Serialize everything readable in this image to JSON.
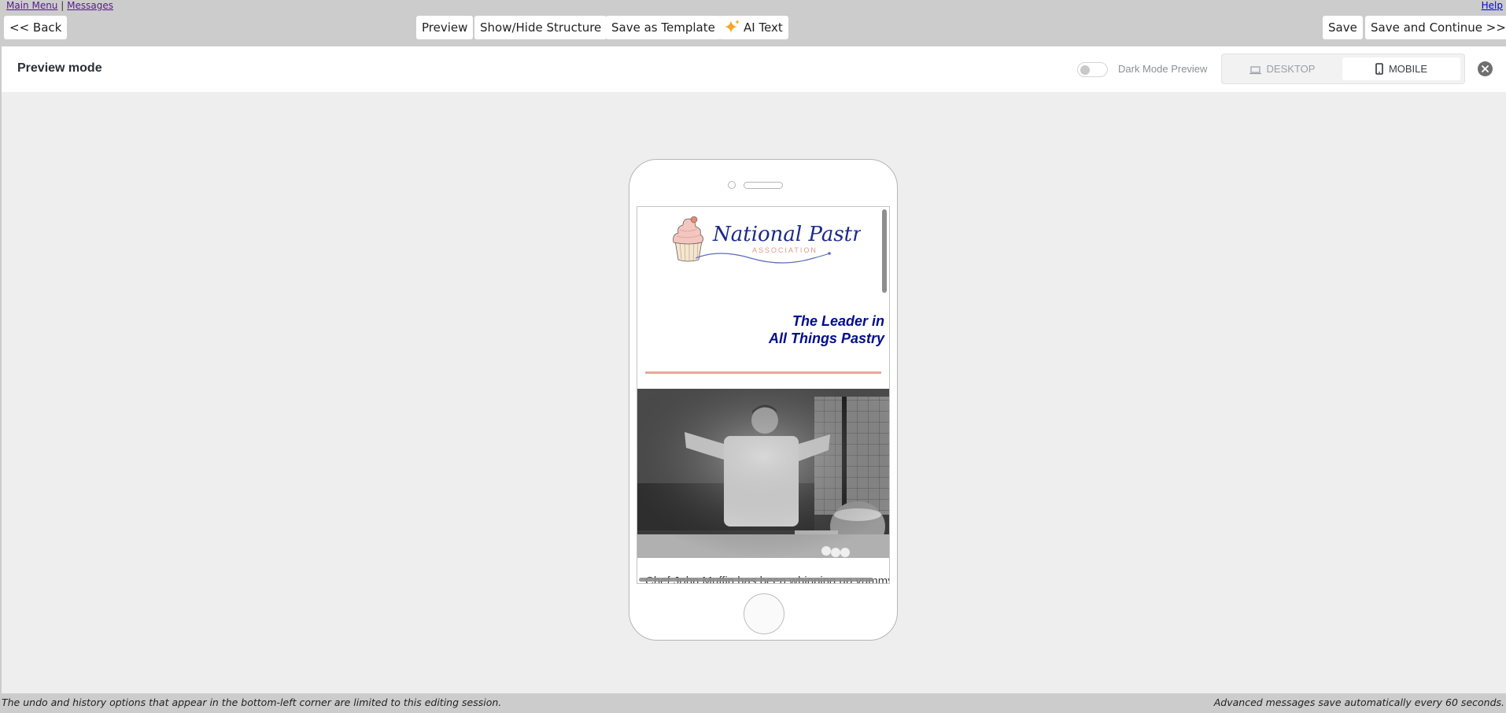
{
  "nav": {
    "main_menu": "Main Menu",
    "separator": "|",
    "messages": "Messages",
    "help": "Help"
  },
  "toolbar": {
    "back": "<< Back",
    "preview": "Preview",
    "show_hide_structure": "Show/Hide Structure",
    "save_as_template": "Save as Template",
    "ai_text": "AI Text",
    "ai_text_icon": "sparkle-icon",
    "save": "Save",
    "save_and_continue": "Save and Continue >>"
  },
  "preview_header": {
    "title": "Preview mode",
    "dark_mode_label": "Dark Mode Preview",
    "dark_mode_on": false,
    "device_options": [
      {
        "label": "DESKTOP",
        "icon": "laptop-icon",
        "selected": false
      },
      {
        "label": "MOBILE",
        "icon": "phone-icon",
        "selected": true
      }
    ],
    "close_icon": "close-icon"
  },
  "email": {
    "logo": {
      "name": "National Pastries",
      "subtitle": "ASSOCIATION"
    },
    "tagline_line1": "The Leader in",
    "tagline_line2": "All Things Pastry",
    "hero_alt": "Chef tossing flour in a kitchen",
    "body_text": "Chef John Muffin has been whipping up yummy"
  },
  "colors": {
    "toolbar_bg": "#cccccc",
    "panel_bg": "#eeeeee",
    "tagline": "#000e8c",
    "divider": "#e9a89c",
    "logo_blue": "#1b2a8a",
    "logo_pink": "#e3988a",
    "sparkle": "#f5a623"
  },
  "footer": {
    "left": "The undo and history options that appear in the bottom-left corner are limited to this editing session.",
    "right": "Advanced messages save automatically every 60 seconds."
  }
}
